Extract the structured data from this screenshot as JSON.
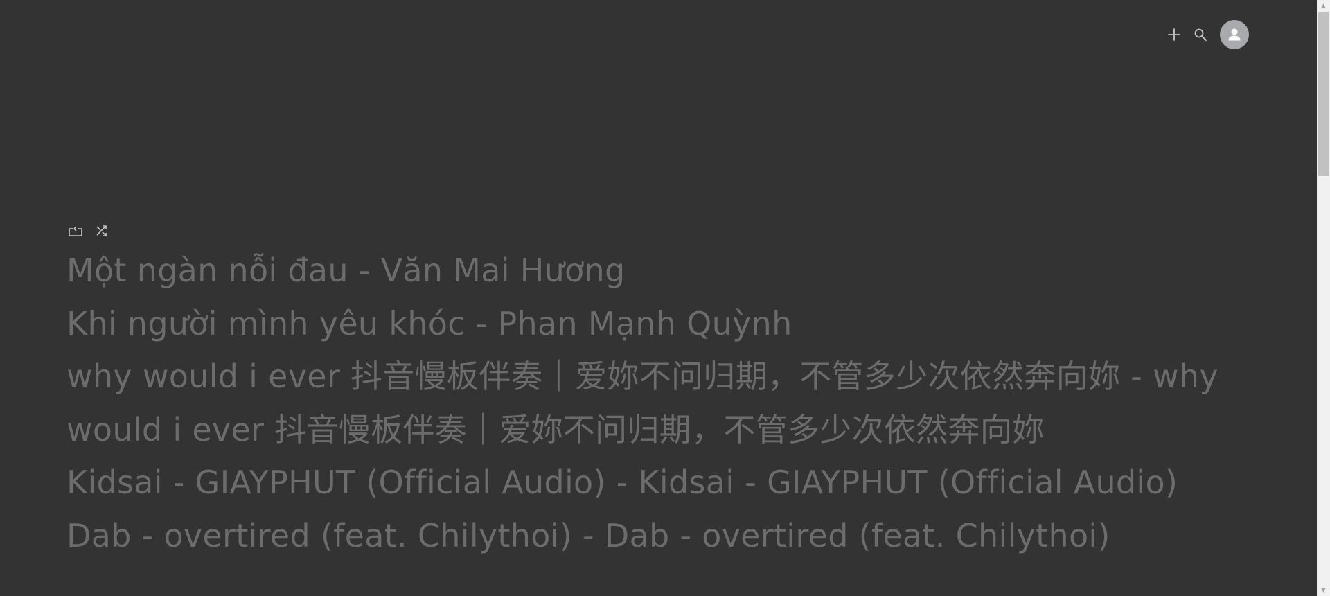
{
  "header": {
    "add_icon": "plus-icon",
    "search_icon": "search-icon",
    "avatar_icon": "user-icon"
  },
  "controls": {
    "repeat_icon": "repeat-icon",
    "shuffle_icon": "shuffle-icon"
  },
  "tracks": [
    {
      "label": "Một ngàn nỗi đau - Văn Mai Hương"
    },
    {
      "label": "Khi người mình yêu khóc - Phan Mạnh Quỳnh"
    },
    {
      "label": "why would i ever 抖音慢板伴奏｜爱妳不问归期，不管多少次依然奔向妳 - why would i ever 抖音慢板伴奏｜爱妳不问归期，不管多少次依然奔向妳"
    },
    {
      "label": "Kidsai - GIAYPHUT (Official Audio) - Kidsai - GIAYPHUT (Official Audio)"
    },
    {
      "label": "Dab - overtired (feat. Chilythoi) - Dab - overtired (feat. Chilythoi)"
    }
  ],
  "colors": {
    "background": "#333333",
    "track_text": "#6c6c6c",
    "icon": "#c8c8c8",
    "avatar_bg": "#a9aaae",
    "scrollbar_track": "#f1f1f1",
    "scrollbar_thumb": "#c1c1c1"
  }
}
